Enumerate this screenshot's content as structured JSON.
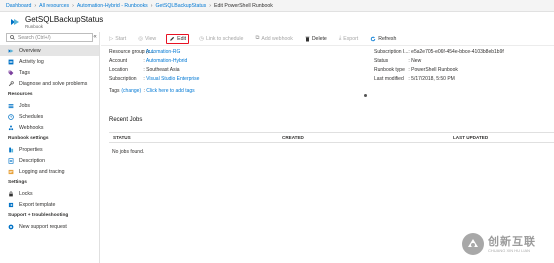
{
  "breadcrumb": {
    "items": [
      "Dashboard",
      "All resources",
      "Automation-Hybrid - Runbooks",
      "GetSQLBackupStatus"
    ],
    "current": "Edit PowerShell Runbook"
  },
  "header": {
    "title": "GetSQLBackupStatus",
    "subtitle": "Runbook"
  },
  "sidebar": {
    "search_placeholder": "Search (Ctrl+/)",
    "collapse_label": "«",
    "top_items": [
      {
        "label": "Overview",
        "icon": "runbook-icon",
        "color": "#0072c6"
      },
      {
        "label": "Activity log",
        "icon": "activity-log-icon",
        "color": "#0072c6"
      },
      {
        "label": "Tags",
        "icon": "tag-icon",
        "color": "#7a3e9d"
      },
      {
        "label": "Diagnose and solve problems",
        "icon": "wrench-icon",
        "color": "#555555"
      }
    ],
    "resources_header": "Resources",
    "resources_items": [
      {
        "label": "Jobs",
        "icon": "jobs-icon",
        "color": "#0072c6"
      },
      {
        "label": "Schedules",
        "icon": "clock-icon",
        "color": "#0072c6"
      },
      {
        "label": "Webhooks",
        "icon": "webhook-icon",
        "color": "#0072c6"
      }
    ],
    "settings_header": "Runbook settings",
    "settings_items": [
      {
        "label": "Properties",
        "icon": "properties-icon",
        "color": "#0072c6"
      },
      {
        "label": "Description",
        "icon": "description-icon",
        "color": "#0072c6"
      },
      {
        "label": "Logging and tracing",
        "icon": "logging-icon",
        "color": "#e8a33d"
      }
    ],
    "general_header": "Settings",
    "general_items": [
      {
        "label": "Locks",
        "icon": "lock-icon",
        "color": "#333333"
      },
      {
        "label": "Export template",
        "icon": "export-template-icon",
        "color": "#0072c6"
      }
    ],
    "support_header": "Support + troubleshooting",
    "support_items": [
      {
        "label": "New support request",
        "icon": "support-icon",
        "color": "#0072c6"
      }
    ]
  },
  "toolbar": {
    "start": "Start",
    "view": "View",
    "edit": "Edit",
    "link_schedule": "Link to schedule",
    "add_webhook": "Add webhook",
    "delete": "Delete",
    "export": "Export",
    "refresh": "Refresh"
  },
  "essentials": {
    "resource_group_label": "Resource group (c...",
    "resource_group_value": "Automation-RG",
    "account_label": "Account",
    "account_value": "Automation-Hybrid",
    "location_label": "Location",
    "location_value": "Southeast Asia",
    "subscription_label": "Subscription",
    "subscription_value": "Visual Studio Enterprise",
    "tags_label": "Tags",
    "tags_change": "(change)",
    "tags_add": "Click here to add tags",
    "subscription_id_label": "Subscription I...",
    "subscription_id_value": "e5a2e705-e06f-454e-bbce-4103b8eb1b9f",
    "status_label": "Status",
    "status_value": "New",
    "runbook_type_label": "Runbook type",
    "runbook_type_value": "PowerShell Runbook",
    "last_modified_label": "Last modified",
    "last_modified_value": "5/17/2018, 5:50 PM",
    "separator": ":"
  },
  "recent_jobs": {
    "title": "Recent Jobs",
    "columns": [
      "STATUS",
      "CREATED",
      "LAST UPDATED"
    ],
    "empty_message": "No jobs found."
  },
  "watermark": {
    "chinese": "创新互联",
    "english": "CHUANG XIN HU LIAN"
  },
  "colors": {
    "accent": "#0078d4",
    "edit_highlight": "#e81123",
    "sidebar_active": "#e5e5e5"
  }
}
